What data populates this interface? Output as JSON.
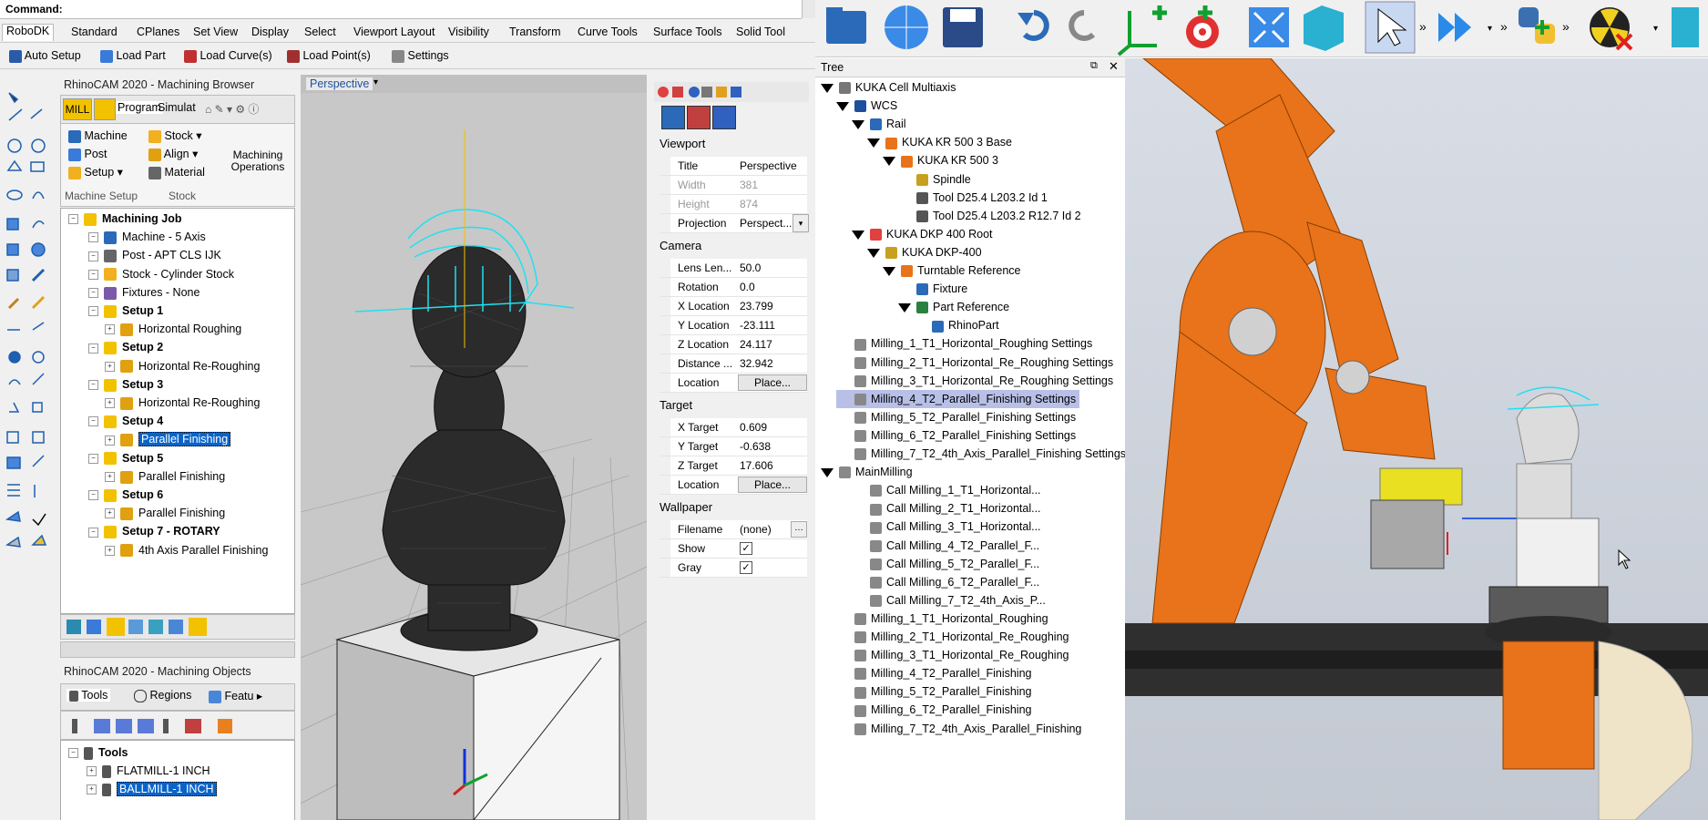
{
  "rhino": {
    "command_label": "Command:",
    "ribbon_tabs": [
      "RoboDK",
      "Standard",
      "CPlanes",
      "Set View",
      "Display",
      "Select",
      "Viewport Layout",
      "Visibility",
      "Transform",
      "Curve Tools",
      "Surface Tools",
      "Solid Tool"
    ],
    "robodk_bar": {
      "auto_setup": "Auto Setup",
      "load_part": "Load Part",
      "load_curves": "Load Curve(s)",
      "load_points": "Load Point(s)",
      "settings": "Settings"
    },
    "browser": {
      "title": "RhinoCAM 2020 - Machining Browser",
      "tabs": [
        "MILL",
        "Program",
        "Simulat"
      ],
      "group_machine": {
        "machine": "Machine",
        "post": "Post",
        "setup": "Setup",
        "label": "Machine Setup"
      },
      "group_stock": {
        "stock": "Stock",
        "align": "Align",
        "material": "Material",
        "label": "Stock"
      },
      "machining_ops": "Machining Operations",
      "tree": [
        {
          "label": "Machining Job",
          "level": 0,
          "bold": true
        },
        {
          "label": "Machine - 5 Axis",
          "level": 1
        },
        {
          "label": "Post - APT CLS IJK",
          "level": 1
        },
        {
          "label": "Stock - Cylinder Stock",
          "level": 1
        },
        {
          "label": "Fixtures - None",
          "level": 1
        },
        {
          "label": "Setup 1",
          "level": 1,
          "bold": true
        },
        {
          "label": "Horizontal Roughing",
          "level": 2
        },
        {
          "label": "Setup 2",
          "level": 1,
          "bold": true
        },
        {
          "label": "Horizontal Re-Roughing",
          "level": 2
        },
        {
          "label": "Setup 3",
          "level": 1,
          "bold": true
        },
        {
          "label": "Horizontal Re-Roughing",
          "level": 2
        },
        {
          "label": "Setup 4",
          "level": 1,
          "bold": true
        },
        {
          "label": "Parallel Finishing",
          "level": 2,
          "selected": true
        },
        {
          "label": "Setup 5",
          "level": 1,
          "bold": true
        },
        {
          "label": "Parallel Finishing",
          "level": 2
        },
        {
          "label": "Setup 6",
          "level": 1,
          "bold": true
        },
        {
          "label": "Parallel Finishing",
          "level": 2
        },
        {
          "label": "Setup 7 - ROTARY",
          "level": 1,
          "bold": true
        },
        {
          "label": "4th Axis Parallel Finishing",
          "level": 2
        }
      ]
    },
    "objects": {
      "title": "RhinoCAM 2020 - Machining Objects",
      "tabs": [
        "Tools",
        "Regions",
        "Featu"
      ],
      "tree": [
        {
          "label": "Tools",
          "level": 0,
          "bold": true
        },
        {
          "label": "FLATMILL-1 INCH",
          "level": 1
        },
        {
          "label": "BALLMILL-1 INCH",
          "level": 1,
          "selected": true
        }
      ]
    },
    "viewport_title": "Perspective",
    "properties": {
      "viewport_header": "Viewport",
      "viewport": [
        {
          "k": "Title",
          "v": "Perspective"
        },
        {
          "k": "Width",
          "v": "381",
          "disabled": true
        },
        {
          "k": "Height",
          "v": "874",
          "disabled": true
        },
        {
          "k": "Projection",
          "v": "Perspect..."
        }
      ],
      "camera_header": "Camera",
      "camera": [
        {
          "k": "Lens Len...",
          "v": "50.0"
        },
        {
          "k": "Rotation",
          "v": "0.0"
        },
        {
          "k": "X Location",
          "v": "23.799"
        },
        {
          "k": "Y Location",
          "v": "-23.111"
        },
        {
          "k": "Z Location",
          "v": "24.117"
        },
        {
          "k": "Distance ...",
          "v": "32.942"
        },
        {
          "k": "Location",
          "v": "Place...",
          "button": true
        }
      ],
      "target_header": "Target",
      "target": [
        {
          "k": "X Target",
          "v": "0.609"
        },
        {
          "k": "Y Target",
          "v": "-0.638"
        },
        {
          "k": "Z Target",
          "v": "17.606"
        },
        {
          "k": "Location",
          "v": "Place...",
          "button": true
        }
      ],
      "wallpaper_header": "Wallpaper",
      "wallpaper": [
        {
          "k": "Filename",
          "v": "(none)"
        },
        {
          "k": "Show",
          "v": ""
        },
        {
          "k": "Gray",
          "v": ""
        }
      ]
    }
  },
  "robodk": {
    "tree_title": "Tree",
    "tree": [
      {
        "label": "KUKA Cell Multiaxis",
        "x": 0,
        "tri": true
      },
      {
        "label": "WCS",
        "x": 1,
        "tri": true
      },
      {
        "label": "Rail",
        "x": 2,
        "tri": true
      },
      {
        "label": "KUKA KR 500 3 Base",
        "x": 3,
        "tri": true
      },
      {
        "label": "KUKA KR 500 3",
        "x": 4,
        "tri": true
      },
      {
        "label": "Spindle",
        "x": 5
      },
      {
        "label": "Tool D25.4 L203.2 Id 1",
        "x": 5
      },
      {
        "label": "Tool D25.4 L203.2 R12.7 Id 2",
        "x": 5
      },
      {
        "label": "KUKA DKP 400 Root",
        "x": 2,
        "tri": true
      },
      {
        "label": "KUKA DKP-400",
        "x": 3,
        "tri": true
      },
      {
        "label": "Turntable Reference",
        "x": 4,
        "tri": true
      },
      {
        "label": "Fixture",
        "x": 5
      },
      {
        "label": "Part Reference",
        "x": 5,
        "tri": true
      },
      {
        "label": "RhinoPart",
        "x": 6
      },
      {
        "label": "Milling_1_T1_Horizontal_Roughing Settings",
        "x": 1
      },
      {
        "label": "Milling_2_T1_Horizontal_Re_Roughing Settings",
        "x": 1
      },
      {
        "label": "Milling_3_T1_Horizontal_Re_Roughing Settings",
        "x": 1
      },
      {
        "label": "Milling_4_T2_Parallel_Finishing Settings",
        "x": 1,
        "selected": true
      },
      {
        "label": "Milling_5_T2_Parallel_Finishing Settings",
        "x": 1
      },
      {
        "label": "Milling_6_T2_Parallel_Finishing Settings",
        "x": 1
      },
      {
        "label": "Milling_7_T2_4th_Axis_Parallel_Finishing Settings",
        "x": 1
      },
      {
        "label": "MainMilling",
        "x": 0,
        "tri": true
      },
      {
        "label": "Call Milling_1_T1_Horizontal...",
        "x": 2
      },
      {
        "label": "Call Milling_2_T1_Horizontal...",
        "x": 2
      },
      {
        "label": "Call Milling_3_T1_Horizontal...",
        "x": 2
      },
      {
        "label": "Call Milling_4_T2_Parallel_F...",
        "x": 2
      },
      {
        "label": "Call Milling_5_T2_Parallel_F...",
        "x": 2
      },
      {
        "label": "Call Milling_6_T2_Parallel_F...",
        "x": 2
      },
      {
        "label": "Call Milling_7_T2_4th_Axis_P...",
        "x": 2
      },
      {
        "label": "Milling_1_T1_Horizontal_Roughing",
        "x": 1
      },
      {
        "label": "Milling_2_T1_Horizontal_Re_Roughing",
        "x": 1
      },
      {
        "label": "Milling_3_T1_Horizontal_Re_Roughing",
        "x": 1
      },
      {
        "label": "Milling_4_T2_Parallel_Finishing",
        "x": 1
      },
      {
        "label": "Milling_5_T2_Parallel_Finishing",
        "x": 1
      },
      {
        "label": "Milling_6_T2_Parallel_Finishing",
        "x": 1
      },
      {
        "label": "Milling_7_T2_4th_Axis_Parallel_Finishing",
        "x": 1
      }
    ],
    "toolbar_icons": [
      "open-folder-icon",
      "globe-icon",
      "save-icon",
      "undo-icon",
      "redo-icon",
      "add-frame-icon",
      "add-target-icon",
      "fit-all-icon",
      "iso-view-icon",
      "select-icon",
      "run-program-icon",
      "python-icon",
      "collision-icon"
    ]
  },
  "colors": {
    "selection": "#0a64c8",
    "robodk_selection": "#b8c0e8",
    "robot": "#e8731a",
    "toolpath": "#20e0f0"
  }
}
